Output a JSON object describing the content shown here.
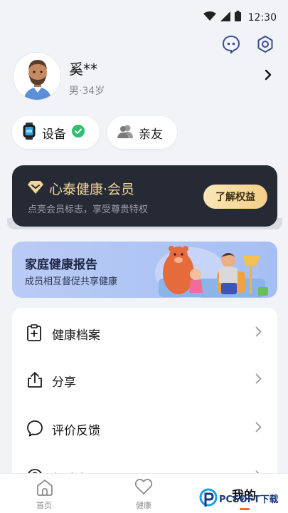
{
  "status_bar": {
    "time": "12:30"
  },
  "profile": {
    "name": "奚**",
    "meta": "男·34岁"
  },
  "chips": {
    "device": {
      "label": "设备",
      "status": "connected"
    },
    "family": {
      "label": "亲友"
    }
  },
  "membership": {
    "title": "心泰健康·会员",
    "subtitle": "点亮会员标志，享受尊贵特权",
    "button": "了解权益"
  },
  "family_report": {
    "title": "家庭健康报告",
    "subtitle": "成员相互督促共享健康"
  },
  "menu": {
    "items": [
      {
        "label": "健康档案",
        "icon": "health-record-icon"
      },
      {
        "label": "分享",
        "icon": "share-icon"
      },
      {
        "label": "评价反馈",
        "icon": "feedback-icon"
      },
      {
        "label": "帮助中心",
        "icon": "help-icon"
      }
    ]
  },
  "tabs": [
    {
      "label": "首页",
      "icon": "home-icon"
    },
    {
      "label": "健康",
      "icon": "heart-icon"
    },
    {
      "label": "我的",
      "active": true
    }
  ],
  "watermark": {
    "text": "PCSOFT下载"
  },
  "colors": {
    "accent": "#ff6a2b",
    "member_card": "#252a35",
    "member_gold": "#f0d69a",
    "check_green": "#2fbf71",
    "family_blue": "#a6bff3",
    "icon_blue": "#3a4d8f"
  }
}
